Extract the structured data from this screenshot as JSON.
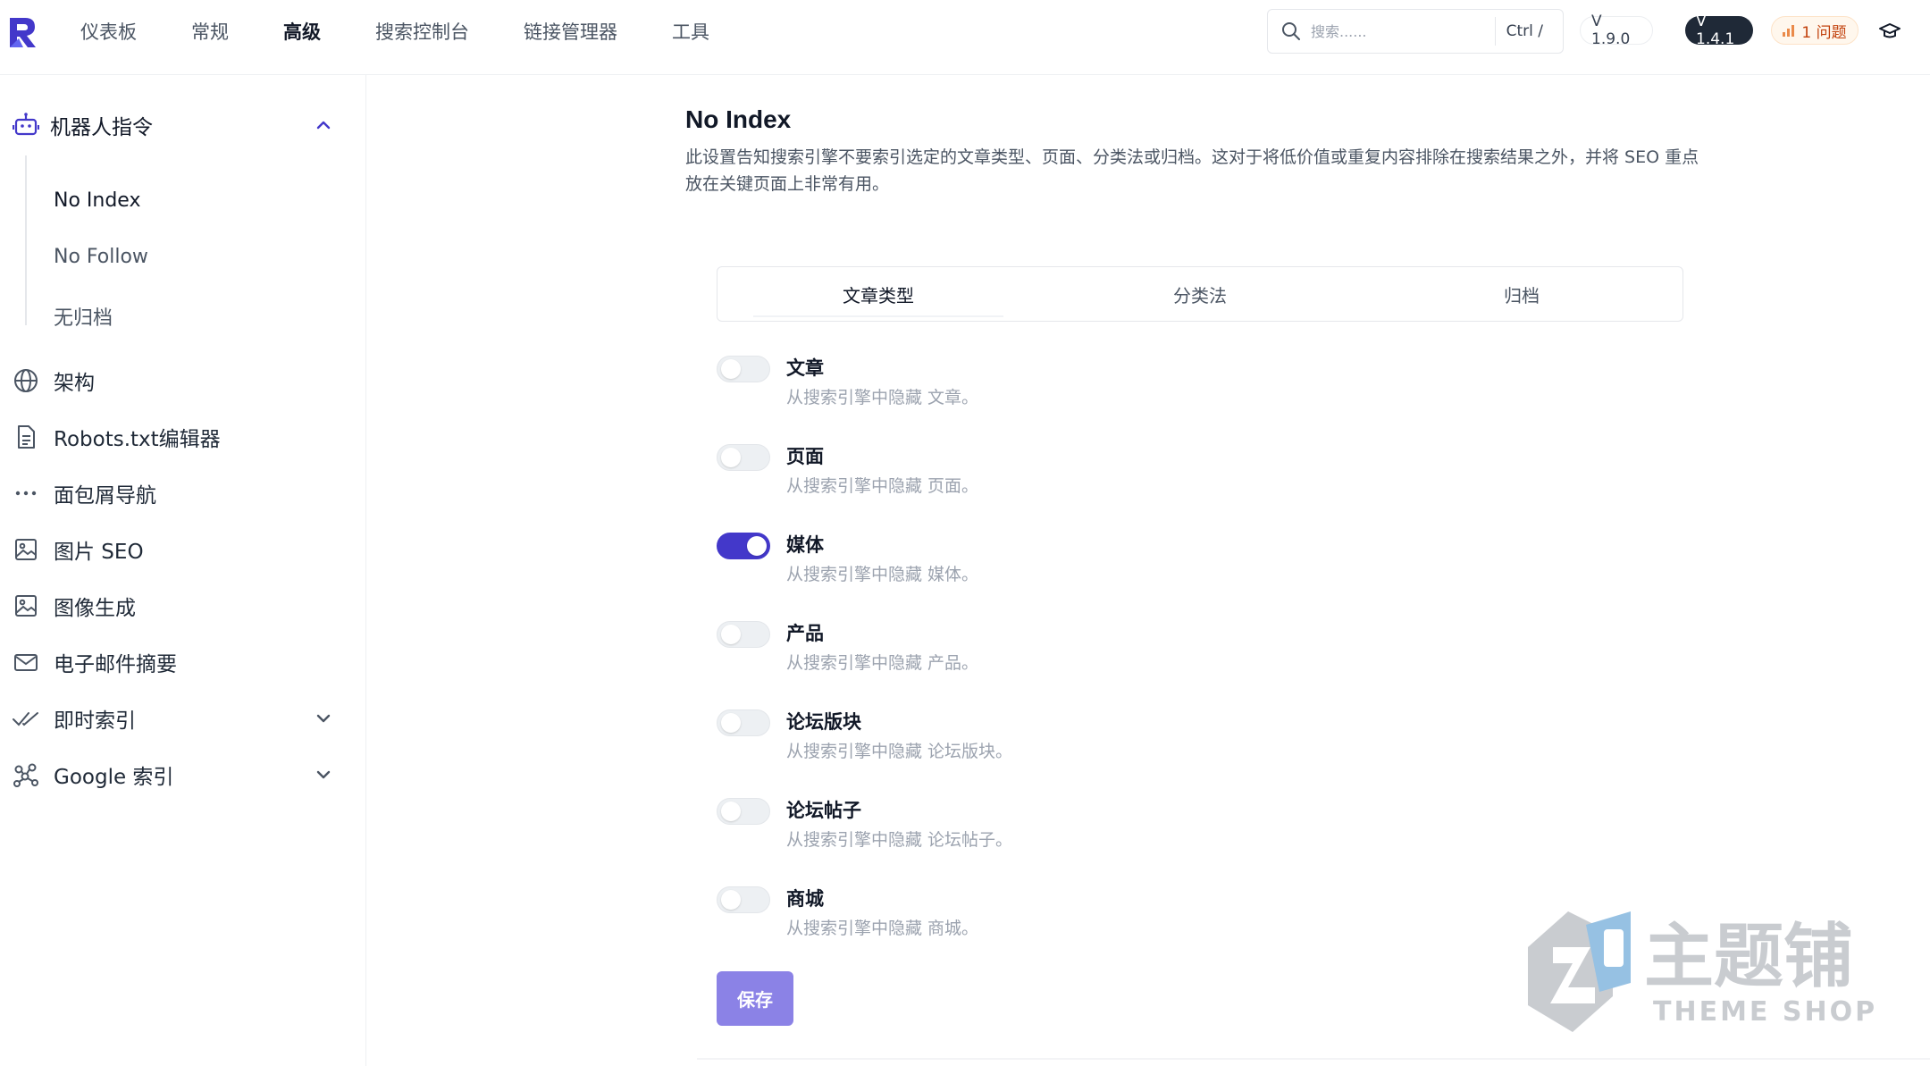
{
  "topbar": {
    "nav": [
      "仪表板",
      "常规",
      "高级",
      "搜索控制台",
      "链接管理器",
      "工具"
    ],
    "active_nav": 2,
    "search_placeholder": "搜索......",
    "shortcut": "Ctrl /",
    "version_free": "V 1.9.0",
    "version_pro": "V 1.4.1",
    "issues": "1 问题",
    "accent": "#4338ca"
  },
  "sidebar": {
    "robots_header": "机器人指令",
    "sub_items": [
      "No Index",
      "No Follow",
      "无归档"
    ],
    "items": [
      {
        "label": "架构",
        "icon": "globe-icon"
      },
      {
        "label": "Robots.txt编辑器",
        "icon": "document-icon"
      },
      {
        "label": "面包屑导航",
        "icon": "ellipsis-icon"
      },
      {
        "label": "图片 SEO",
        "icon": "image-icon"
      },
      {
        "label": "图像生成",
        "icon": "image-icon"
      },
      {
        "label": "电子邮件摘要",
        "icon": "mail-icon"
      },
      {
        "label": "即时索引",
        "icon": "double-check-icon"
      },
      {
        "label": "Google 索引",
        "icon": "network-icon"
      }
    ]
  },
  "main": {
    "title": "No Index",
    "description": "此设置告知搜索引擎不要索引选定的文章类型、页面、分类法或归档。这对于将低价值或重复内容排除在搜索结果之外，并将 SEO 重点放在关键页面上非常有用。",
    "tabs": [
      "文章类型",
      "分类法",
      "归档"
    ],
    "active_tab": 0,
    "options": [
      {
        "title": "文章",
        "desc": "从搜索引擎中隐藏 文章。",
        "enabled": false
      },
      {
        "title": "页面",
        "desc": "从搜索引擎中隐藏 页面。",
        "enabled": false
      },
      {
        "title": "媒体",
        "desc": "从搜索引擎中隐藏 媒体。",
        "enabled": true
      },
      {
        "title": "产品",
        "desc": "从搜索引擎中隐藏 产品。",
        "enabled": false
      },
      {
        "title": "论坛版块",
        "desc": "从搜索引擎中隐藏 论坛版块。",
        "enabled": false
      },
      {
        "title": "论坛帖子",
        "desc": "从搜索引擎中隐藏 论坛帖子。",
        "enabled": false
      },
      {
        "title": "商城",
        "desc": "从搜索引擎中隐藏 商城。",
        "enabled": false
      }
    ],
    "save_label": "保存"
  },
  "watermark": {
    "cn": "主题铺",
    "en": "THEME SHOP"
  }
}
